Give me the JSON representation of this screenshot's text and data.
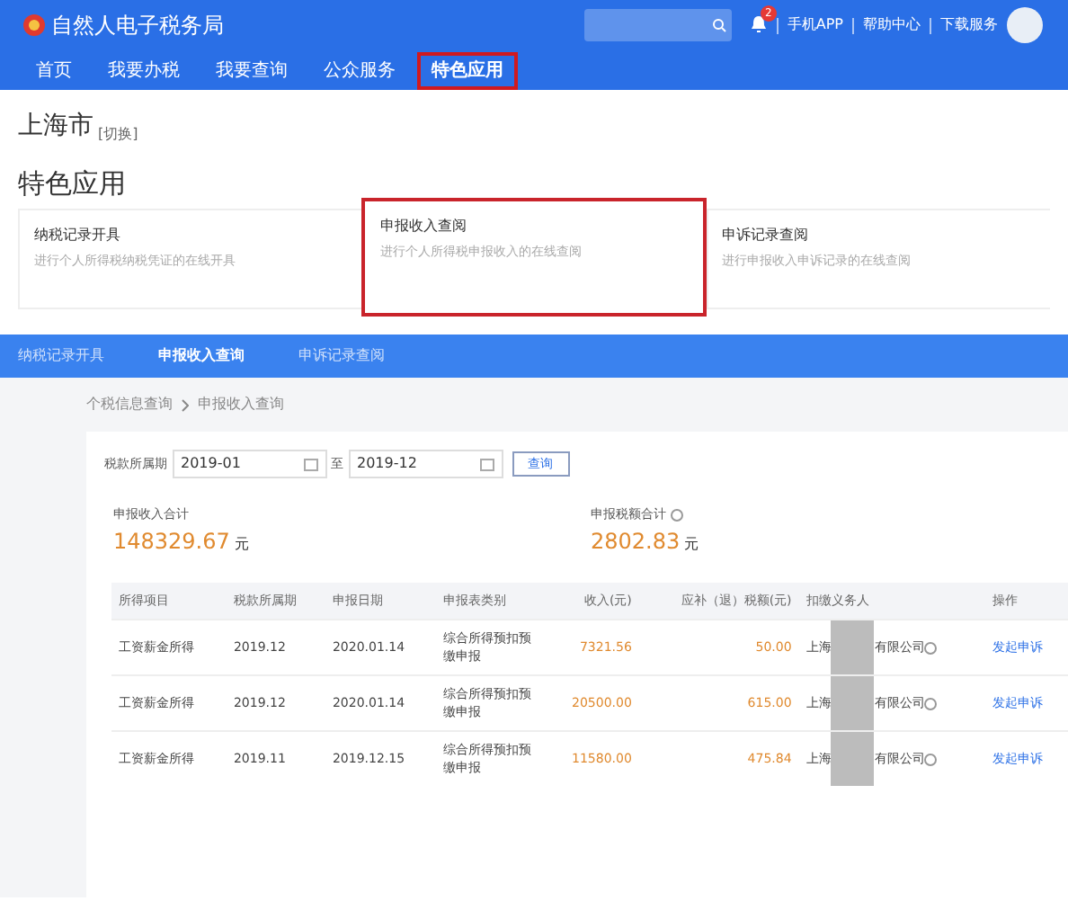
{
  "header": {
    "site_title": "自然人电子税务局",
    "notification_count": "2",
    "links": [
      "手机APP",
      "帮助中心",
      "下载服务"
    ]
  },
  "nav": [
    {
      "label": "首页",
      "selected": false,
      "highlighted": false
    },
    {
      "label": "我要办税",
      "selected": false,
      "highlighted": false
    },
    {
      "label": "我要查询",
      "selected": false,
      "highlighted": false
    },
    {
      "label": "公众服务",
      "selected": false,
      "highlighted": false
    },
    {
      "label": "特色应用",
      "selected": true,
      "highlighted": true
    }
  ],
  "location": {
    "city": "上海市",
    "switch": "[切换]"
  },
  "section_title": "特色应用",
  "apps": [
    {
      "title": "纳税记录开具",
      "desc": "进行个人所得税纳税凭证的在线开具",
      "highlighted": false
    },
    {
      "title": "申报收入查阅",
      "desc": "进行个人所得税申报收入的在线查阅",
      "highlighted": true
    },
    {
      "title": "申诉记录查阅",
      "desc": "进行申报收入申诉记录的在线查阅",
      "highlighted": false
    }
  ],
  "subtabs": [
    {
      "label": "纳税记录开具",
      "selected": false
    },
    {
      "label": "申报收入查询",
      "selected": true
    },
    {
      "label": "申诉记录查阅",
      "selected": false
    }
  ],
  "breadcrumb": [
    "个税信息查询",
    "申报收入查询"
  ],
  "filter": {
    "label": "税款所属期",
    "from": "2019-01",
    "to_label": "至",
    "to": "2019-12",
    "button": "查询"
  },
  "totals": [
    {
      "label": "申报收入合计",
      "value": "148329.67",
      "unit": "元",
      "info": false
    },
    {
      "label": "申报税额合计",
      "value": "2802.83",
      "unit": "元",
      "info": true
    }
  ],
  "table": {
    "columns": [
      "所得项目",
      "税款所属期",
      "申报日期",
      "申报表类别",
      "收入(元)",
      "应补（退）税额(元)",
      "扣缴义务人",
      "操作"
    ],
    "rows": [
      {
        "item": "工资薪金所得",
        "period": "2019.12",
        "date": "2020.01.14",
        "form": "综合所得预扣预缴申报",
        "income": "7321.56",
        "tax": "50.00",
        "agent_start": "上海",
        "agent_end": "有限公司",
        "action": "发起申诉"
      },
      {
        "item": "工资薪金所得",
        "period": "2019.12",
        "date": "2020.01.14",
        "form": "综合所得预扣预缴申报",
        "income": "20500.00",
        "tax": "615.00",
        "agent_start": "上海",
        "agent_end": "有限公司",
        "action": "发起申诉"
      },
      {
        "item": "工资薪金所得",
        "period": "2019.11",
        "date": "2019.12.15",
        "form": "综合所得预扣预缴申报",
        "income": "11580.00",
        "tax": "475.84",
        "agent_start": "上海",
        "agent_end": "有限公司",
        "action": "发起申诉"
      }
    ]
  }
}
